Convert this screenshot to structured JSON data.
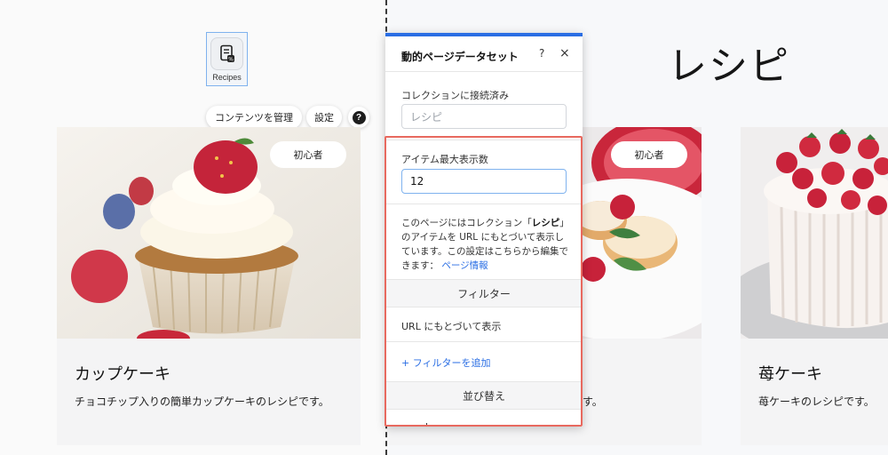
{
  "page": {
    "title": "レシピ"
  },
  "dataset_icon": {
    "label": "Recipes",
    "icon": "dataset-icon"
  },
  "actions": {
    "manage_label": "コンテンツを管理",
    "settings_label": "設定",
    "help_label": "?"
  },
  "cards": [
    {
      "title": "カップケーキ",
      "description": "チョコチップ入りの簡単カップケーキのレシピです。",
      "badge": "初心者"
    },
    {
      "title": "",
      "description": "す。",
      "badge": "初心者"
    },
    {
      "title": "苺ケーキ",
      "description": "苺ケーキのレシピです。",
      "badge": ""
    }
  ],
  "panel": {
    "title": "動的ページデータセット",
    "help_label": "?",
    "close_label": "×",
    "collection_label": "コレクションに接続済み",
    "collection_value": "レシピ",
    "max_items_label": "アイテム最大表示数",
    "max_items_value": "12",
    "info_prefix": "このページにはコレクション「",
    "info_collection": "レシピ",
    "info_suffix": "」のアイテムを URL にもとづいて表示しています。この設定はこちらから編集できます：",
    "info_link": "ページ情報",
    "filter_section": "フィルター",
    "filter_row": "URL にもとづいて表示",
    "add_filter_label": "+ フィルターを追加",
    "sort_section": "並び替え",
    "sort_row": "order"
  },
  "colors": {
    "accent": "#2a6ee4",
    "highlight": "#e8695f",
    "card_bg": "#f4f4f5"
  }
}
